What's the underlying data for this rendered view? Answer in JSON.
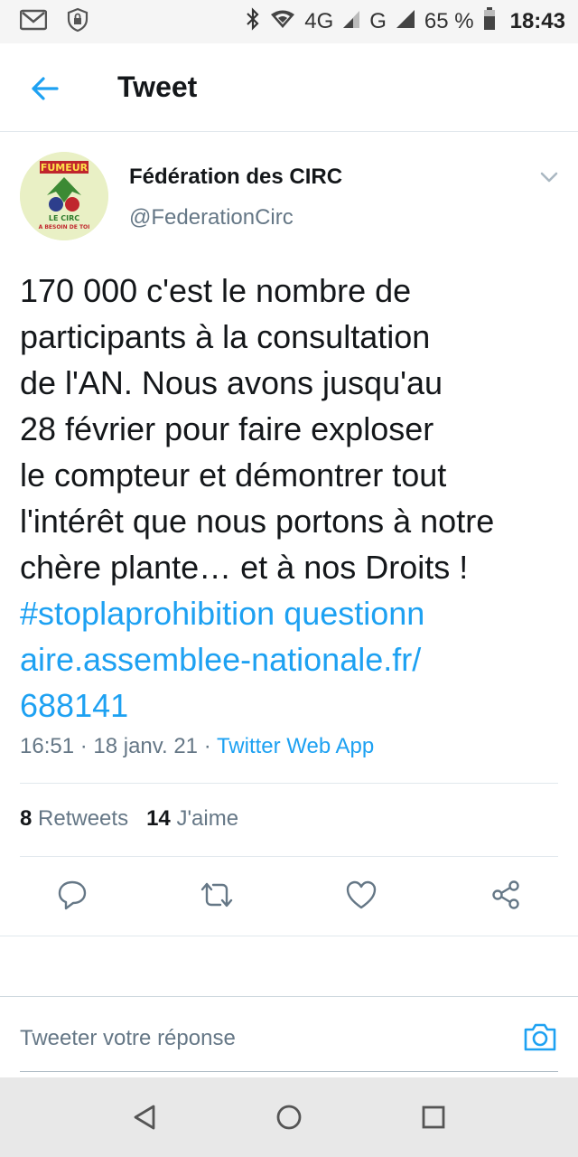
{
  "status_bar": {
    "network_4g": "4G",
    "network_g": "G",
    "battery": "65 %",
    "time": "18:43",
    "icons": [
      "gmail-icon",
      "shield-icon",
      "bluetooth-icon",
      "wifi-icon",
      "signal-icon",
      "signal-icon",
      "battery-icon"
    ]
  },
  "header": {
    "title": "Tweet",
    "back_icon": "arrow-left-icon"
  },
  "tweet": {
    "author_name": "Fédération des CIRC",
    "author_handle": "@FederationCirc",
    "avatar_text_top": "FUMEUR",
    "avatar_text_mid": "LE CIRC",
    "avatar_text_bot": "A BESOIN DE TOI",
    "text_lines": [
      "170 000 c'est le nombre de",
      "participants à la consultation",
      "de l'AN. Nous avons jusqu'au",
      "28 février pour faire exploser",
      "le compteur et démontrer tout",
      "l'intérêt que nous portons à notre",
      "chère plante… et à nos Droits !"
    ],
    "link_lines": [
      "#stoplaprohibition questionn",
      "aire.assemblee-nationale.fr/",
      "688141"
    ],
    "time": "16:51",
    "date": "18 janv. 21",
    "source": "Twitter Web App",
    "retweets_count": "8",
    "retweets_label": "Retweets",
    "likes_count": "14",
    "likes_label": "J'aime"
  },
  "reply": {
    "placeholder": "Tweeter votre réponse"
  },
  "colors": {
    "accent": "#1da1f2",
    "text": "#14171a",
    "secondary": "#657786",
    "status_bg": "#f5f5f5",
    "nav_bg": "#e8e8e8"
  }
}
